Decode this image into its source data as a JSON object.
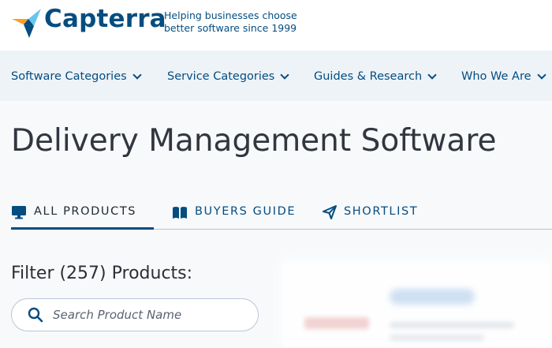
{
  "brand": {
    "name": "Capterra",
    "tagline_line1": "Helping businesses choose",
    "tagline_line2": "better software since 1999",
    "colors": {
      "navy": "#044d80",
      "orange": "#ff9d28",
      "blue": "#68c5ed"
    }
  },
  "nav": {
    "items": [
      {
        "label": "Software Categories",
        "icon": "chevron-down-icon"
      },
      {
        "label": "Service Categories",
        "icon": "chevron-down-icon"
      },
      {
        "label": "Guides & Research",
        "icon": "chevron-down-icon"
      },
      {
        "label": "Who We Are",
        "icon": "chevron-down-icon"
      }
    ]
  },
  "page": {
    "title": "Delivery Management Software"
  },
  "tabs": [
    {
      "label": "ALL PRODUCTS",
      "icon": "monitor-icon",
      "active": true
    },
    {
      "label": "BUYERS GUIDE",
      "icon": "book-icon",
      "active": false
    },
    {
      "label": "SHORTLIST",
      "icon": "paper-plane-icon",
      "active": false
    }
  ],
  "filter": {
    "title": "Filter (257) Products:",
    "search_placeholder": "Search Product Name"
  }
}
